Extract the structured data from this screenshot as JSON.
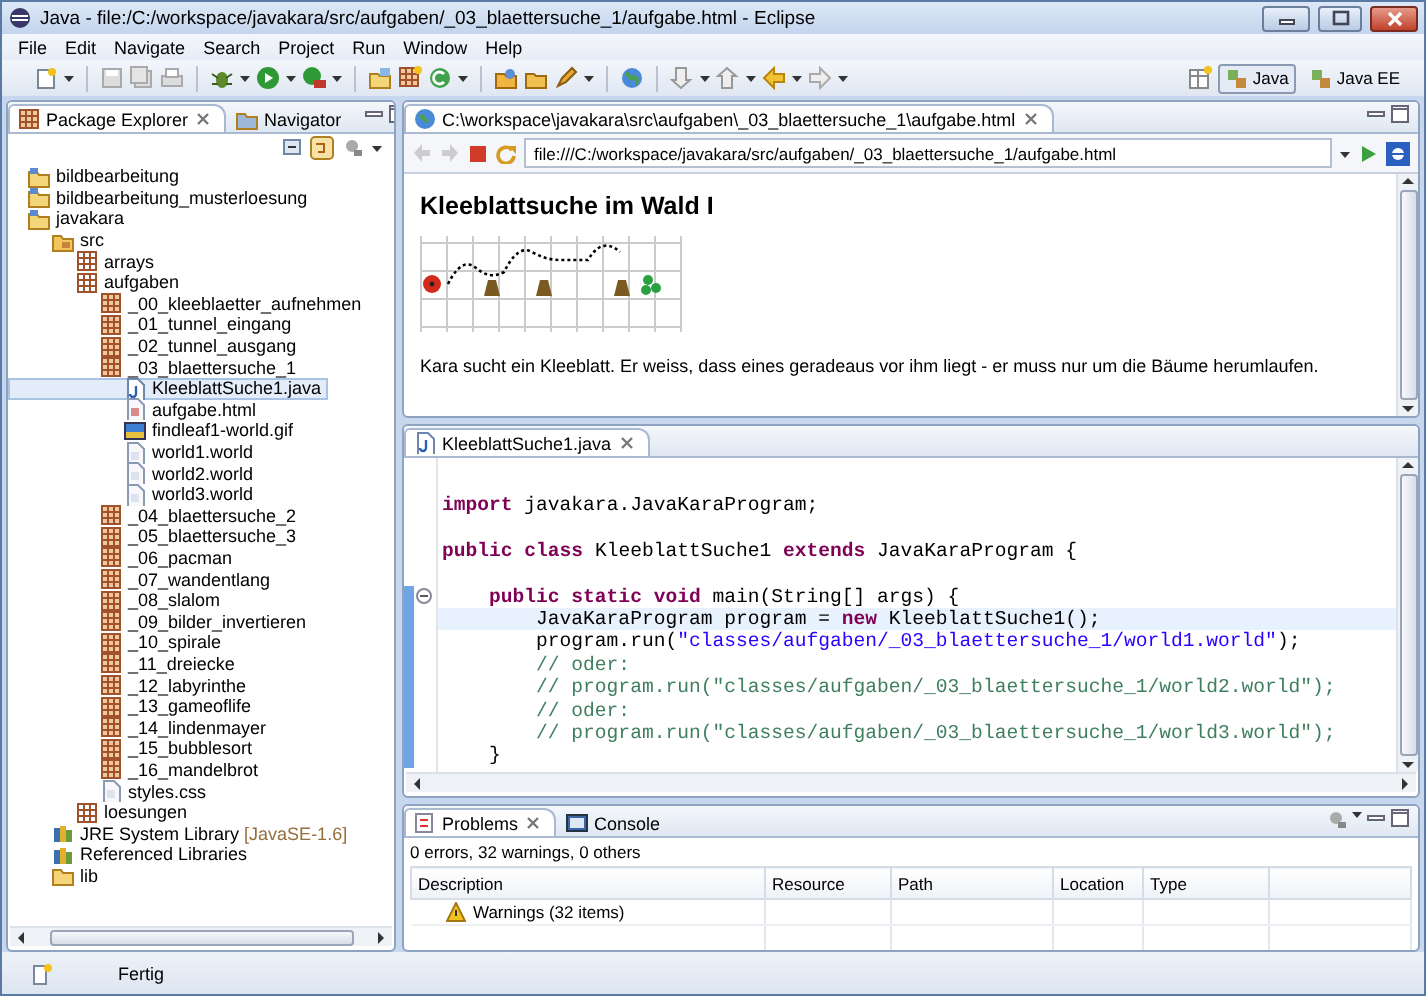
{
  "window": {
    "title": "Java - file:/C:/workspace/javakara/src/aufgaben/_03_blaettersuche_1/aufgabe.html - Eclipse"
  },
  "menu": [
    "File",
    "Edit",
    "Navigate",
    "Search",
    "Project",
    "Run",
    "Window",
    "Help"
  ],
  "perspectives": [
    {
      "label": "Java",
      "selected": true
    },
    {
      "label": "Java EE",
      "selected": false
    }
  ],
  "left_tabs": [
    {
      "label": "Package Explorer",
      "selected": true
    },
    {
      "label": "Navigator",
      "selected": false
    }
  ],
  "tree": {
    "items": [
      {
        "label": "bildbearbeitung",
        "kind": "project",
        "selected": false
      },
      {
        "label": "bildbearbeitung_musterloesung",
        "kind": "project",
        "selected": false
      },
      {
        "label": "javakara",
        "kind": "project",
        "selected": false,
        "children": [
          {
            "label": "src",
            "kind": "source_folder",
            "selected": false,
            "children": [
              {
                "label": "arrays",
                "kind": "package_group",
                "selected": false
              },
              {
                "label": "aufgaben",
                "kind": "package_group",
                "selected": false,
                "children": [
                  {
                    "label": "_00_kleeblaetter_aufnehmen",
                    "kind": "package",
                    "selected": false
                  },
                  {
                    "label": "_01_tunnel_eingang",
                    "kind": "package",
                    "selected": false
                  },
                  {
                    "label": "_02_tunnel_ausgang",
                    "kind": "package",
                    "selected": false
                  },
                  {
                    "label": "_03_blaettersuche_1",
                    "kind": "package",
                    "selected": false,
                    "children": [
                      {
                        "label": "KleeblattSuche1.java",
                        "kind": "java",
                        "selected": true
                      },
                      {
                        "label": "aufgabe.html",
                        "kind": "html",
                        "selected": false
                      },
                      {
                        "label": "findleaf1-world.gif",
                        "kind": "image",
                        "selected": false
                      },
                      {
                        "label": "world1.world",
                        "kind": "file",
                        "selected": false
                      },
                      {
                        "label": "world2.world",
                        "kind": "file",
                        "selected": false
                      },
                      {
                        "label": "world3.world",
                        "kind": "file",
                        "selected": false
                      }
                    ]
                  },
                  {
                    "label": "_04_blaettersuche_2",
                    "kind": "package",
                    "selected": false
                  },
                  {
                    "label": "_05_blaettersuche_3",
                    "kind": "package",
                    "selected": false
                  },
                  {
                    "label": "_06_pacman",
                    "kind": "package",
                    "selected": false
                  },
                  {
                    "label": "_07_wandentlang",
                    "kind": "package",
                    "selected": false
                  },
                  {
                    "label": "_08_slalom",
                    "kind": "package",
                    "selected": false
                  },
                  {
                    "label": "_09_bilder_invertieren",
                    "kind": "package",
                    "selected": false
                  },
                  {
                    "label": "_10_spirale",
                    "kind": "package",
                    "selected": false
                  },
                  {
                    "label": "_11_dreiecke",
                    "kind": "package",
                    "selected": false
                  },
                  {
                    "label": "_12_labyrinthe",
                    "kind": "package",
                    "selected": false
                  },
                  {
                    "label": "_13_gameoflife",
                    "kind": "package",
                    "selected": false
                  },
                  {
                    "label": "_14_lindenmayer",
                    "kind": "package",
                    "selected": false
                  },
                  {
                    "label": "_15_bubblesort",
                    "kind": "package",
                    "selected": false
                  },
                  {
                    "label": "_16_mandelbrot",
                    "kind": "package",
                    "selected": false
                  },
                  {
                    "label": "styles.css",
                    "kind": "file",
                    "selected": false
                  }
                ]
              },
              {
                "label": "loesungen",
                "kind": "package_group",
                "selected": false
              }
            ]
          },
          {
            "label": "JRE System Library",
            "decoration": "[JavaSE-1.6]",
            "kind": "library",
            "selected": false
          },
          {
            "label": "Referenced Libraries",
            "kind": "library",
            "selected": false
          },
          {
            "label": "lib",
            "kind": "folder",
            "selected": false
          }
        ]
      }
    ]
  },
  "browser": {
    "tab": "C:\\workspace\\javakara\\src\\aufgaben\\_03_blaettersuche_1\\aufgabe.html",
    "url": "file:///C:/workspace/javakara/src/aufgaben/_03_blaettersuche_1/aufgabe.html",
    "heading": "Kleeblattsuche im Wald I",
    "paragraph": "Kara sucht ein Kleeblatt. Er weiss, dass eines geradeaus vor ihm liegt - er muss nur um die Bäume herumlaufen."
  },
  "editor": {
    "tab": "KleeblattSuche1.java",
    "lines": [
      {
        "current": false,
        "tokens": [
          {
            "kind": "keyword",
            "text": "import"
          },
          {
            "kind": "plain",
            "text": " javakara.JavaKaraProgram;"
          }
        ]
      },
      {
        "blank_before": true,
        "current": false,
        "tokens": [
          {
            "kind": "keyword",
            "text": "public class"
          },
          {
            "kind": "plain",
            "text": " KleeblattSuche1 "
          },
          {
            "kind": "keyword",
            "text": "extends"
          },
          {
            "kind": "plain",
            "text": " JavaKaraProgram {"
          }
        ]
      },
      {
        "blank_before": true,
        "foldable": true,
        "range": true,
        "current": false,
        "tokens": [
          {
            "kind": "keyword",
            "text": "    public static void"
          },
          {
            "kind": "plain",
            "text": " main(String[] args) {"
          }
        ]
      },
      {
        "current": true,
        "range": true,
        "tokens": [
          {
            "kind": "plain",
            "text": "        JavaKaraProgram program = "
          },
          {
            "kind": "keyword",
            "text": "new"
          },
          {
            "kind": "plain",
            "text": " KleeblattSuche1();"
          }
        ]
      },
      {
        "range": true,
        "current": false,
        "tokens": [
          {
            "kind": "plain",
            "text": "        program.run("
          },
          {
            "kind": "string",
            "text": "\"classes/aufgaben/_03_blaettersuche_1/world1.world\""
          },
          {
            "kind": "plain",
            "text": ");"
          }
        ]
      },
      {
        "range": true,
        "current": false,
        "tokens": [
          {
            "kind": "comment",
            "text": "        // oder:"
          }
        ]
      },
      {
        "range": true,
        "current": false,
        "tokens": [
          {
            "kind": "comment",
            "text": "        // program.run(\"classes/aufgaben/_03_blaettersuche_1/world2.world\");"
          }
        ]
      },
      {
        "range": true,
        "current": false,
        "tokens": [
          {
            "kind": "comment",
            "text": "        // oder:"
          }
        ]
      },
      {
        "range": true,
        "current": false,
        "tokens": [
          {
            "kind": "comment",
            "text": "        // program.run(\"classes/aufgaben/_03_blaettersuche_1/world3.world\");"
          }
        ]
      },
      {
        "range": true,
        "current": false,
        "tokens": [
          {
            "kind": "plain",
            "text": "    }"
          }
        ]
      }
    ]
  },
  "bottom_tabs": [
    {
      "label": "Problems",
      "selected": true
    },
    {
      "label": "Console",
      "selected": false
    }
  ],
  "problems": {
    "summary": "0 errors, 32 warnings, 0 others",
    "columns": [
      "Description",
      "Resource",
      "Path",
      "Location",
      "Type"
    ],
    "rows": [
      {
        "description": "Warnings (32 items)",
        "kind": "warning"
      }
    ]
  },
  "status_bar": {
    "message": "Fertig"
  }
}
